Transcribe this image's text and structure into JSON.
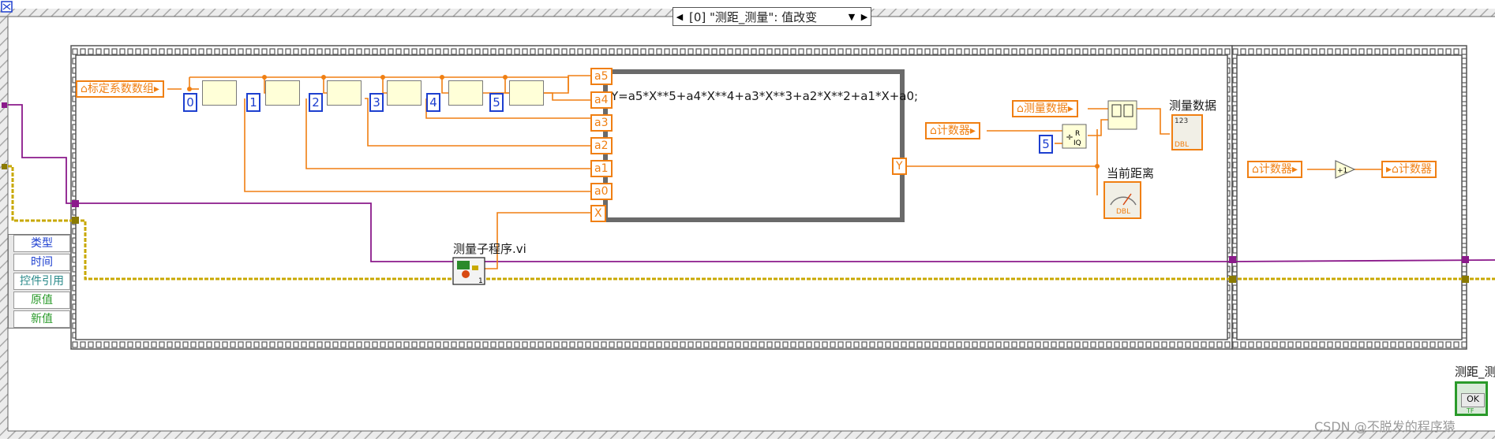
{
  "event_case": {
    "label": "[0] \"测距_测量\": 值改变",
    "prev_arrow": "◀",
    "dropdown_arrow": "▼",
    "next_arrow": "▶"
  },
  "event_data_node": {
    "rows": [
      "类型",
      "时间",
      "控件引用",
      "原值",
      "新值"
    ]
  },
  "controls": {
    "coef_array": "标定系数数组",
    "counter_in": "计数器",
    "measured_data_local": "测量数据",
    "counter_in_2": "计数器",
    "counter_out": "计数器"
  },
  "constants": {
    "indices": [
      "0",
      "1",
      "2",
      "3",
      "4",
      "5"
    ],
    "divisor": "5"
  },
  "formula": {
    "inputs": [
      "a5",
      "a4",
      "a3",
      "a2",
      "a1",
      "a0",
      "X"
    ],
    "output": "Y",
    "expression": "Y=a5*X**5+a4*X**4+a3*X**3+a2*X**2+a1*X+a0;"
  },
  "subvi": {
    "label": "测量子程序.vi"
  },
  "indicators": {
    "measured_data": "测量数据",
    "current_distance": "当前距离",
    "measured_data_type": "DBL",
    "current_distance_type": "DBL"
  },
  "button": {
    "label": "测距_测",
    "face": "OK",
    "type": "TF"
  },
  "watermark": "CSDN @不脱发的程序猿",
  "colors": {
    "numeric_wire": "#f07f12",
    "refnum_wire": "#8b1a8b",
    "error_wire": "#c8a800",
    "structure_frame": "#555555",
    "boolean": "#2a9a2a",
    "integer_const": "#1d3fcf"
  }
}
